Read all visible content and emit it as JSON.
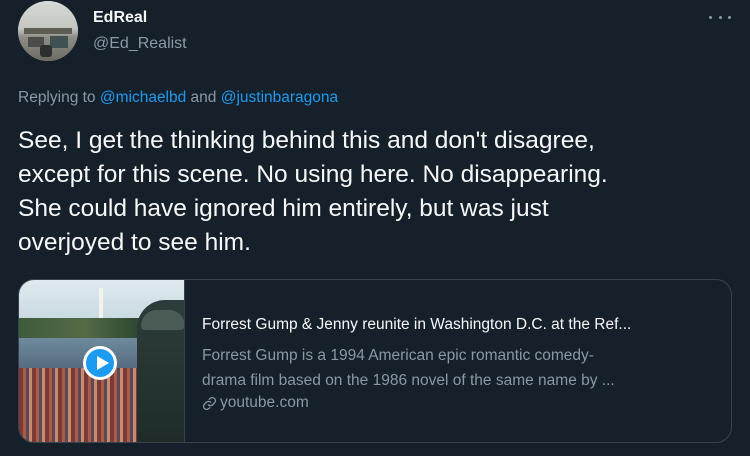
{
  "author": {
    "display_name": "EdReal",
    "handle": "@Ed_Realist"
  },
  "reply": {
    "prefix": "Replying to ",
    "mention_1": "@michaelbd",
    "joiner": " and ",
    "mention_2": "@justinbaragona"
  },
  "tweet": {
    "text": "See, I get the thinking behind this and don't disagree,\nexcept for this scene. No using here. No disappearing.\nShe could have ignored him entirely, but was just\noverjoyed to see him."
  },
  "card": {
    "title": "Forrest Gump & Jenny reunite in Washington D.C. at the Ref...",
    "description_line_1": "Forrest Gump is a 1994 American epic romantic comedy-",
    "description_line_2": "drama film based on the 1986 novel of the same name by ...",
    "source": "youtube.com"
  },
  "colors": {
    "background": "#15202b",
    "link": "#1d9bf0",
    "secondary_text": "#8b98a5",
    "border": "#38444d"
  },
  "icons": {
    "more": "more-horizontal-icon",
    "play": "play-icon",
    "link": "link-icon"
  }
}
